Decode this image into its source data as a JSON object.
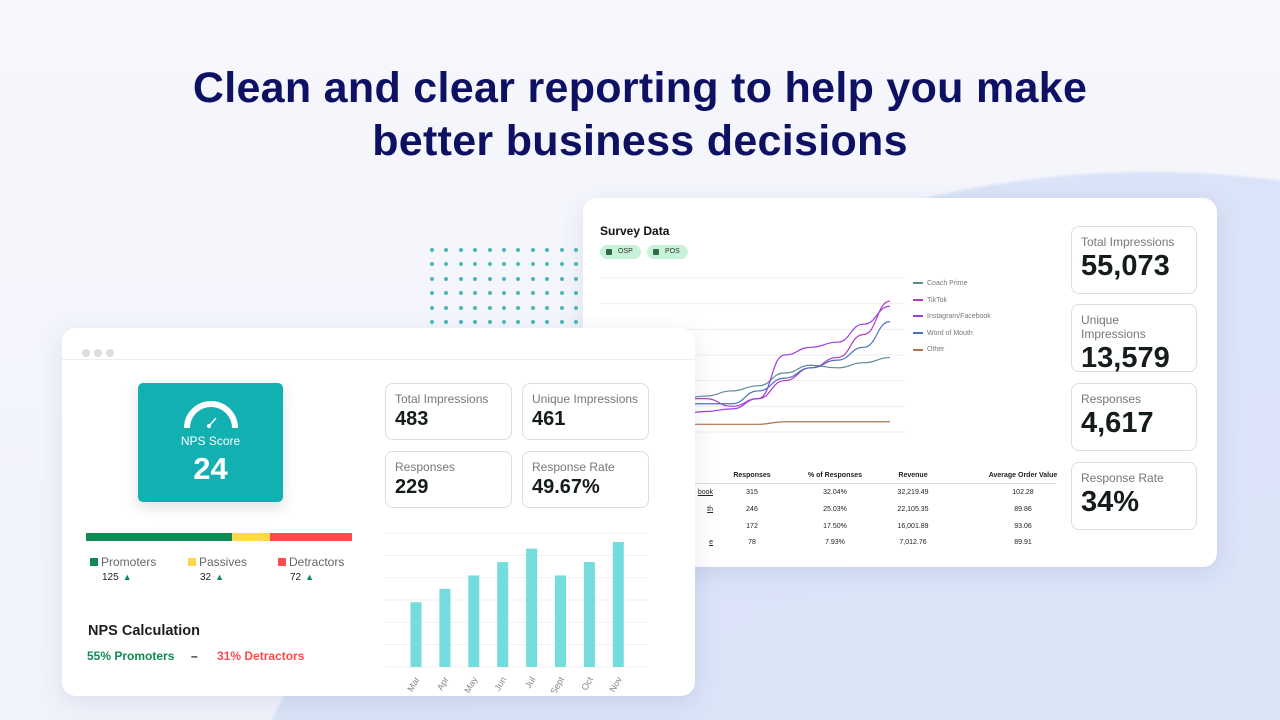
{
  "headline": {
    "line1": "Clean and clear reporting to help you make",
    "line2": "better business decisions"
  },
  "colors": {
    "brand_navy": "#0e1163",
    "teal": "#12b0b0",
    "bar": "#74dcdc",
    "promoters": "#0f8a55",
    "passives": "#fdd84a",
    "detractors": "#fc4b4b"
  },
  "survey": {
    "title": "Survey Data",
    "chips": [
      {
        "label": "OSP"
      },
      {
        "label": "POS"
      }
    ],
    "stats": [
      {
        "label": "Total Impressions",
        "value": "55,073"
      },
      {
        "label": "Unique Impressions",
        "value": "13,579"
      },
      {
        "label": "Responses",
        "value": "4,617"
      },
      {
        "label": "Response Rate",
        "value": "34%"
      }
    ],
    "table": {
      "columns": [
        "Responses",
        "% of Responses",
        "Revenue",
        "Average Order Value"
      ],
      "rows": [
        {
          "source": "book",
          "responses": "315",
          "pct": "32.04%",
          "revenue": "32,219.49",
          "aov": "102.28"
        },
        {
          "source": "th",
          "responses": "246",
          "pct": "25.03%",
          "revenue": "22,105.35",
          "aov": "89.86"
        },
        {
          "source": "",
          "responses": "172",
          "pct": "17.50%",
          "revenue": "16,001.89",
          "aov": "93.06"
        },
        {
          "source": "e",
          "responses": "78",
          "pct": "7.93%",
          "revenue": "7,012.76",
          "aov": "89.91"
        }
      ]
    }
  },
  "chart_data": [
    {
      "type": "line",
      "title": "",
      "ylim": [
        0,
        6
      ],
      "grid": true,
      "legend_placement": "right",
      "series": [
        {
          "name": "Coach Prime",
          "color": "#5a8a94",
          "values": [
            0.9,
            1.1,
            1.3,
            1.3,
            1.4,
            1.6,
            1.8,
            2.3,
            2.6,
            2.5,
            2.7,
            2.9
          ]
        },
        {
          "name": "TikTok",
          "color": "#b53bbd",
          "values": [
            1.3,
            1.3,
            1.3,
            1.3,
            1.3,
            1.0,
            1.3,
            2.0,
            2.5,
            2.9,
            3.8,
            5.1
          ]
        },
        {
          "name": "Instagram/Facebook",
          "color": "#9b3ee0",
          "values": [
            0.5,
            0.5,
            0.6,
            0.7,
            0.8,
            0.9,
            1.3,
            3.0,
            3.3,
            3.5,
            4.2,
            4.9
          ]
        },
        {
          "name": "Word of Mouth",
          "color": "#4a6fc4",
          "values": [
            0.9,
            0.9,
            1.0,
            1.1,
            1.1,
            1.1,
            1.6,
            2.1,
            2.5,
            2.8,
            3.3,
            4.3
          ]
        },
        {
          "name": "Other",
          "color": "#b0734a",
          "values": [
            0.3,
            0.3,
            0.3,
            0.3,
            0.3,
            0.3,
            0.3,
            0.4,
            0.4,
            0.4,
            0.4,
            0.4
          ]
        }
      ]
    },
    {
      "type": "bar",
      "title": "",
      "categories": [
        "Mar",
        "Apr",
        "May",
        "Jun",
        "Jul",
        "Sept",
        "Oct",
        "Nov"
      ],
      "values": [
        2.9,
        3.5,
        4.1,
        4.7,
        5.3,
        4.1,
        4.7,
        5.6
      ],
      "ylim": [
        0,
        6
      ],
      "grid": true
    }
  ],
  "nps": {
    "window_dots": 3,
    "score_label": "NPS Score",
    "score": "24",
    "stats": [
      {
        "label": "Total Impressions",
        "value": "483"
      },
      {
        "label": "Unique Impressions",
        "value": "461"
      },
      {
        "label": "Responses",
        "value": "229"
      },
      {
        "label": "Response Rate",
        "value": "49.67%"
      }
    ],
    "breakdown": [
      {
        "label": "Promoters",
        "count": "125",
        "share": 0.55,
        "color": "#0f8a55"
      },
      {
        "label": "Passives",
        "count": "32",
        "share": 0.14,
        "color": "#fdd84a"
      },
      {
        "label": "Detractors",
        "count": "72",
        "share": 0.31,
        "color": "#fc4b4b"
      }
    ],
    "calc_title": "NPS Calculation",
    "calc_promoters": "55% Promoters",
    "calc_minus": "–",
    "calc_detractors": "31% Detractors"
  }
}
